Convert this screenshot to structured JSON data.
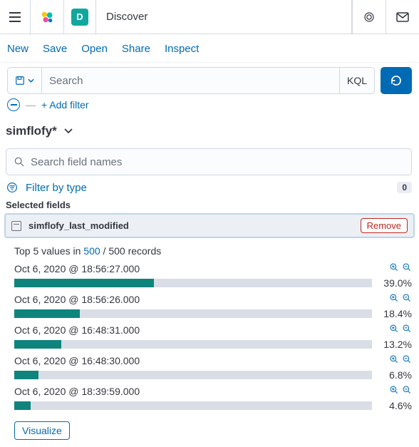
{
  "header": {
    "app_chip": "D",
    "title": "Discover"
  },
  "tabs": {
    "new": "New",
    "save": "Save",
    "open": "Open",
    "share": "Share",
    "inspect": "Inspect"
  },
  "query": {
    "placeholder": "Search",
    "kql": "KQL"
  },
  "filters": {
    "add_label": "+ Add filter"
  },
  "index": {
    "pattern": "simflofy*"
  },
  "field_search": {
    "placeholder": "Search field names"
  },
  "type_filter": {
    "label": "Filter by type",
    "count": "0"
  },
  "selected": {
    "heading": "Selected fields",
    "field_name": "simflofy_last_modified",
    "remove_label": "Remove"
  },
  "stats": {
    "top5_prefix": "Top 5 values in ",
    "top5_count": "500",
    "top5_suffix": " / 500 records",
    "visualize": "Visualize",
    "rows": [
      {
        "label": "Oct 6, 2020 @ 18:56:27.000",
        "pct": "39.0%",
        "width": 39.0
      },
      {
        "label": "Oct 6, 2020 @ 18:56:26.000",
        "pct": "18.4%",
        "width": 18.4
      },
      {
        "label": "Oct 6, 2020 @ 16:48:31.000",
        "pct": "13.2%",
        "width": 13.2
      },
      {
        "label": "Oct 6, 2020 @ 16:48:30.000",
        "pct": "6.8%",
        "width": 6.8
      },
      {
        "label": "Oct 6, 2020 @ 18:39:59.000",
        "pct": "4.6%",
        "width": 4.6
      }
    ]
  }
}
